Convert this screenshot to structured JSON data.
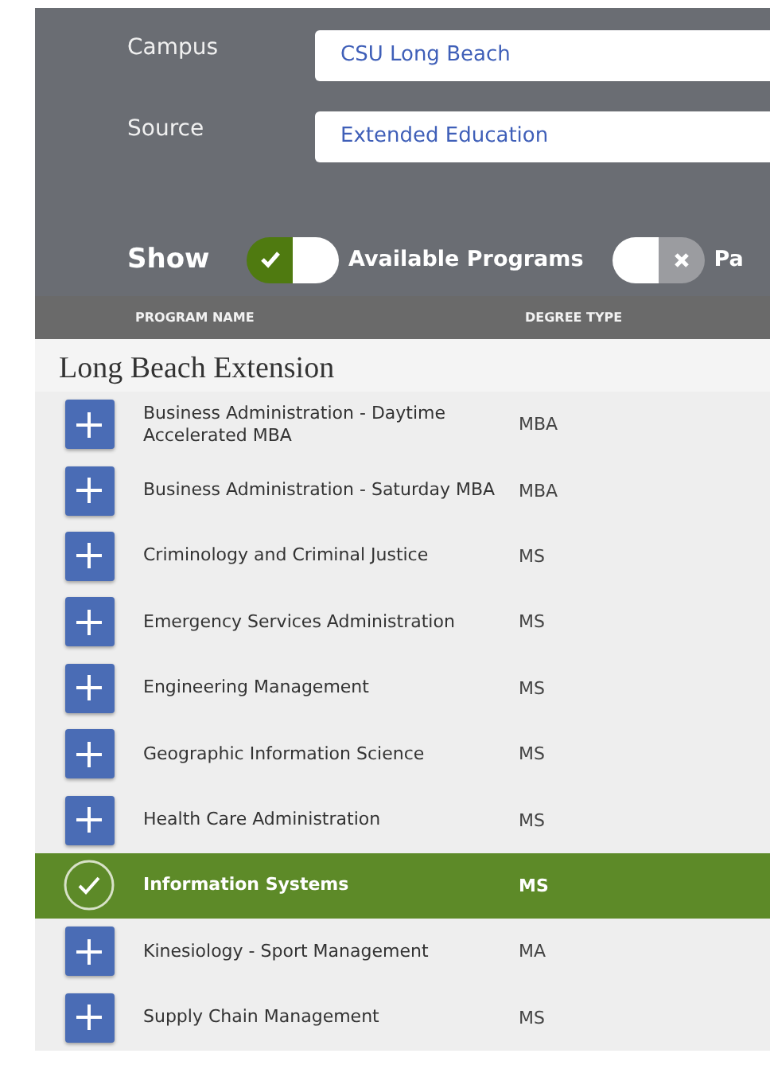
{
  "filters": [
    {
      "label": "Campus",
      "value": "CSU Long Beach"
    },
    {
      "label": "Source",
      "value": "Extended Education"
    }
  ],
  "show": {
    "label": "Show",
    "toggles": [
      {
        "label": "Available Programs",
        "on": true
      },
      {
        "label": "Pa",
        "on": false
      }
    ]
  },
  "table": {
    "columns": [
      "PROGRAM NAME",
      "DEGREE TYPE"
    ],
    "group": "Long Beach Extension",
    "rows": [
      {
        "name": "Business Administration - Daytime Accelerated MBA",
        "degree": "MBA",
        "selected": false
      },
      {
        "name": "Business Administration - Saturday MBA",
        "degree": "MBA",
        "selected": false
      },
      {
        "name": "Criminology and Criminal Justice",
        "degree": "MS",
        "selected": false
      },
      {
        "name": "Emergency Services Administration",
        "degree": "MS",
        "selected": false
      },
      {
        "name": "Engineering Management",
        "degree": "MS",
        "selected": false
      },
      {
        "name": "Geographic Information Science",
        "degree": "MS",
        "selected": false
      },
      {
        "name": "Health Care Administration",
        "degree": "MS",
        "selected": false
      },
      {
        "name": "Information Systems",
        "degree": "MS",
        "selected": true
      },
      {
        "name": "Kinesiology - Sport Management",
        "degree": "MA",
        "selected": false
      },
      {
        "name": "Supply Chain Management",
        "degree": "MS",
        "selected": false
      }
    ]
  }
}
